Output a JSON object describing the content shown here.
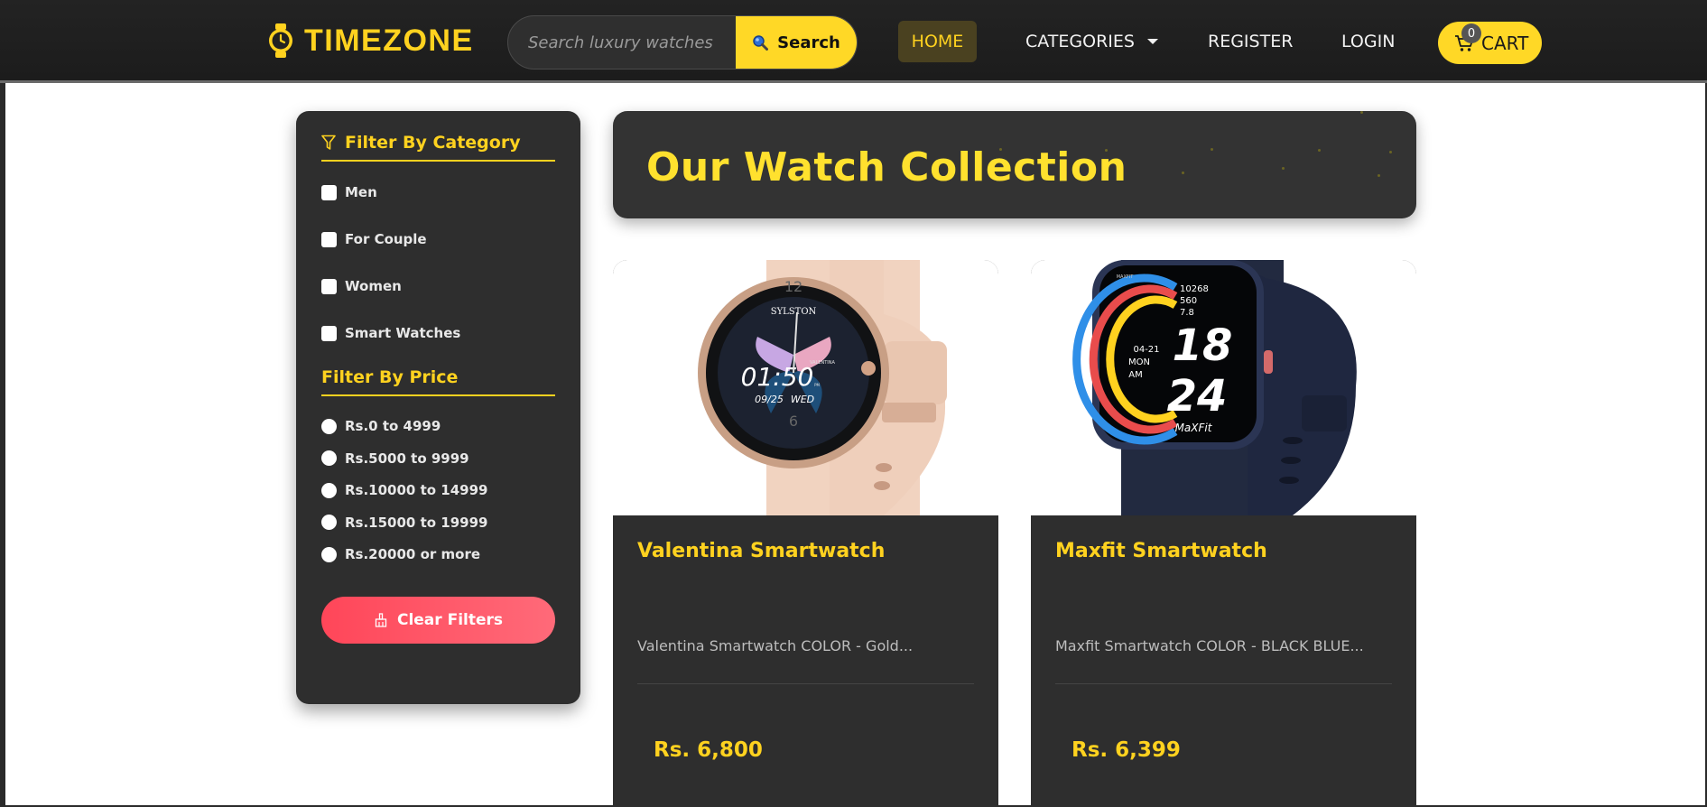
{
  "brand": {
    "name": "TIMEZONE",
    "icon": "watch-icon",
    "accent": "#ffd21f"
  },
  "search": {
    "placeholder": "Search luxury watches",
    "value": "",
    "button_label": "Search",
    "icon": "search-icon"
  },
  "nav": {
    "home": "HOME",
    "categories": "CATEGORIES",
    "register": "REGISTER",
    "login": "LOGIN",
    "cart_label": "CART",
    "cart_count": "0",
    "cart_icon": "cart-icon"
  },
  "sidebar": {
    "category_heading": "Filter By Category",
    "category_icon": "filter-icon",
    "categories": [
      {
        "label": "Men",
        "checked": false
      },
      {
        "label": "For Couple",
        "checked": false
      },
      {
        "label": "Women",
        "checked": false
      },
      {
        "label": "Smart Watches",
        "checked": false
      }
    ],
    "price_heading": "Filter By Price",
    "prices": [
      {
        "label": "Rs.0 to 4999",
        "selected": false
      },
      {
        "label": "Rs.5000 to 9999",
        "selected": false
      },
      {
        "label": "Rs.10000 to 14999",
        "selected": false
      },
      {
        "label": "Rs.15000 to 19999",
        "selected": false
      },
      {
        "label": "Rs.20000 or more",
        "selected": false
      }
    ],
    "clear_label": "Clear Filters",
    "clear_icon": "broom-icon",
    "clear_color": "#ff4f61"
  },
  "banner": {
    "title": "Our Watch Collection"
  },
  "products": [
    {
      "title": "Valentina Smartwatch",
      "description": "Valentina Smartwatch COLOR - Gold...",
      "price": "Rs. 6,800",
      "image": {
        "brand": "SYLSTON",
        "time": "01:50",
        "date": "09/25",
        "day": "WED",
        "dial_text": "VALENTINA",
        "ampm": "PM",
        "dial_numbers": [
          "12",
          "6"
        ]
      }
    },
    {
      "title": "Maxfit Smartwatch",
      "description": "Maxfit Smartwatch COLOR - BLACK BLUE...",
      "price": "Rs. 6,399",
      "image": {
        "brand": "MAXFIT",
        "logo": "MaXFit",
        "steps": "10268",
        "calories": "560",
        "distance": "7.8",
        "date": "04-21",
        "day": "MON",
        "ampm": "AM",
        "hour": "18",
        "minute": "24"
      }
    }
  ]
}
